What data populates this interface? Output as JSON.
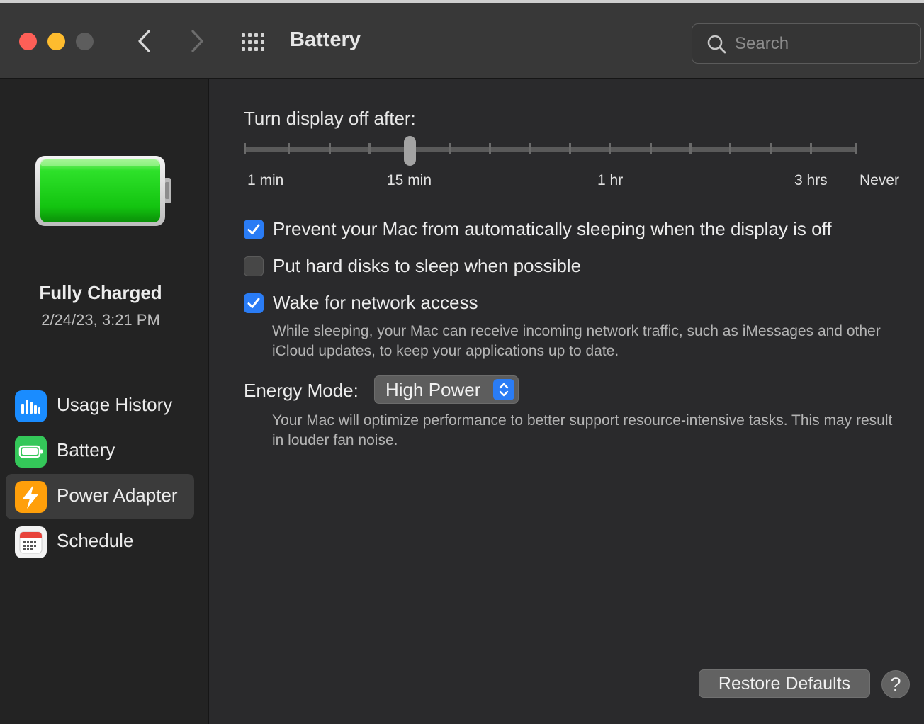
{
  "window": {
    "title": "Battery",
    "search_placeholder": "Search"
  },
  "sidebar": {
    "status": "Fully Charged",
    "timestamp": "2/24/23, 3:21 PM",
    "items": [
      {
        "label": "Usage History",
        "icon": "bar-chart-icon",
        "color": "#1a8cff",
        "selected": false
      },
      {
        "label": "Battery",
        "icon": "battery-icon",
        "color": "#34c759",
        "selected": false
      },
      {
        "label": "Power Adapter",
        "icon": "lightning-bolt-icon",
        "color": "#ff9f0a",
        "selected": true
      },
      {
        "label": "Schedule",
        "icon": "calendar-icon",
        "color": "#f2f2f2",
        "selected": false
      }
    ]
  },
  "main": {
    "display_off_label": "Turn display off after:",
    "slider": {
      "selected": "15 min",
      "tick_labels": [
        "1 min",
        "15 min",
        "1 hr",
        "3 hrs",
        "Never"
      ]
    },
    "options": [
      {
        "label": "Prevent your Mac from automatically sleeping when the display is off",
        "checked": true
      },
      {
        "label": "Put hard disks to sleep when possible",
        "checked": false
      },
      {
        "label": "Wake for network access",
        "checked": true
      }
    ],
    "network_help": "While sleeping, your Mac can receive incoming network traffic, such as iMessages and other iCloud updates, to keep your applications up to date.",
    "energy_mode_label": "Energy Mode:",
    "energy_mode_value": "High Power",
    "energy_help": "Your Mac will optimize performance to better support resource-intensive tasks. This may result in louder fan noise.",
    "restore_button": "Restore Defaults",
    "help_button": "?"
  },
  "colors": {
    "accent": "#2a7cf5",
    "battery_green": "#22d11f"
  }
}
